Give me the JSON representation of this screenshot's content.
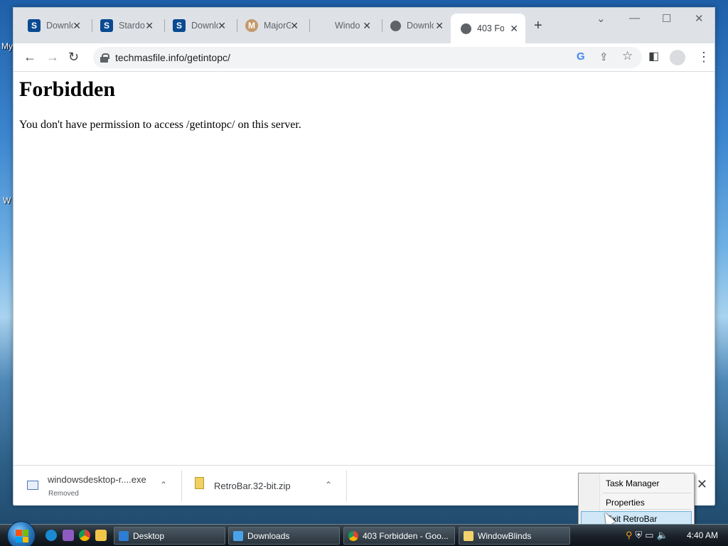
{
  "desktop": {
    "left_labels": [
      "My",
      "W"
    ]
  },
  "browser": {
    "tabs": [
      {
        "title": "Downlo",
        "icon": "softonic-icon",
        "color": "#0a4a91",
        "glyph": "S"
      },
      {
        "title": "Stardo",
        "icon": "softonic-icon",
        "color": "#0a4a91",
        "glyph": "S"
      },
      {
        "title": "Downlo",
        "icon": "softonic-icon",
        "color": "#0a4a91",
        "glyph": "S"
      },
      {
        "title": "MajorG",
        "icon": "majorgeeks-icon",
        "color": "#c49a6c",
        "glyph": "M"
      },
      {
        "title": "Windo",
        "icon": "microsoft-icon",
        "color": "#ffffff",
        "glyph": ""
      },
      {
        "title": "Downlo",
        "icon": "globe-icon",
        "color": "#5f6368",
        "glyph": ""
      },
      {
        "title": "403 Fo",
        "icon": "globe-icon",
        "color": "#5f6368",
        "glyph": "",
        "active": true
      }
    ],
    "tab_close_glyph": "✕",
    "newtab_glyph": "+",
    "window_controls": {
      "tab_search": "⌄",
      "minimize": "—",
      "maximize": "☐",
      "close": "✕"
    },
    "toolbar": {
      "back": "←",
      "forward": "→",
      "reload": "↻",
      "url": "techmasfile.info/getintopc/",
      "google": "G",
      "share": "⇪",
      "bookmark": "☆",
      "sidepanel": "◧",
      "menu": "⋮"
    },
    "page": {
      "heading": "Forbidden",
      "message": "You don't have permission to access /getintopc/ on this server."
    },
    "downloads": [
      {
        "name": "windowsdesktop-r....exe",
        "status": "Removed"
      },
      {
        "name": "RetroBar.32-bit.zip",
        "status": ""
      }
    ],
    "downloads_caret": "⌃",
    "downloads_close": "✕"
  },
  "context_menu": {
    "items": [
      "Task Manager",
      "Properties",
      "Exit RetroBar"
    ],
    "highlighted": "Exit RetroBar"
  },
  "taskbar": {
    "tasks": [
      {
        "label": "Desktop",
        "color": "#2d7dd2"
      },
      {
        "label": "Downloads",
        "color": "#4aa3e8"
      },
      {
        "label": "403 Forbidden - Goo...",
        "color": "#e8b93a"
      },
      {
        "label": "WindowBlinds",
        "color": "#f3d36b"
      }
    ],
    "clock": "4:40 AM",
    "tray_icons": [
      "search-icon",
      "security-icon",
      "network-icon",
      "volume-icon"
    ]
  }
}
